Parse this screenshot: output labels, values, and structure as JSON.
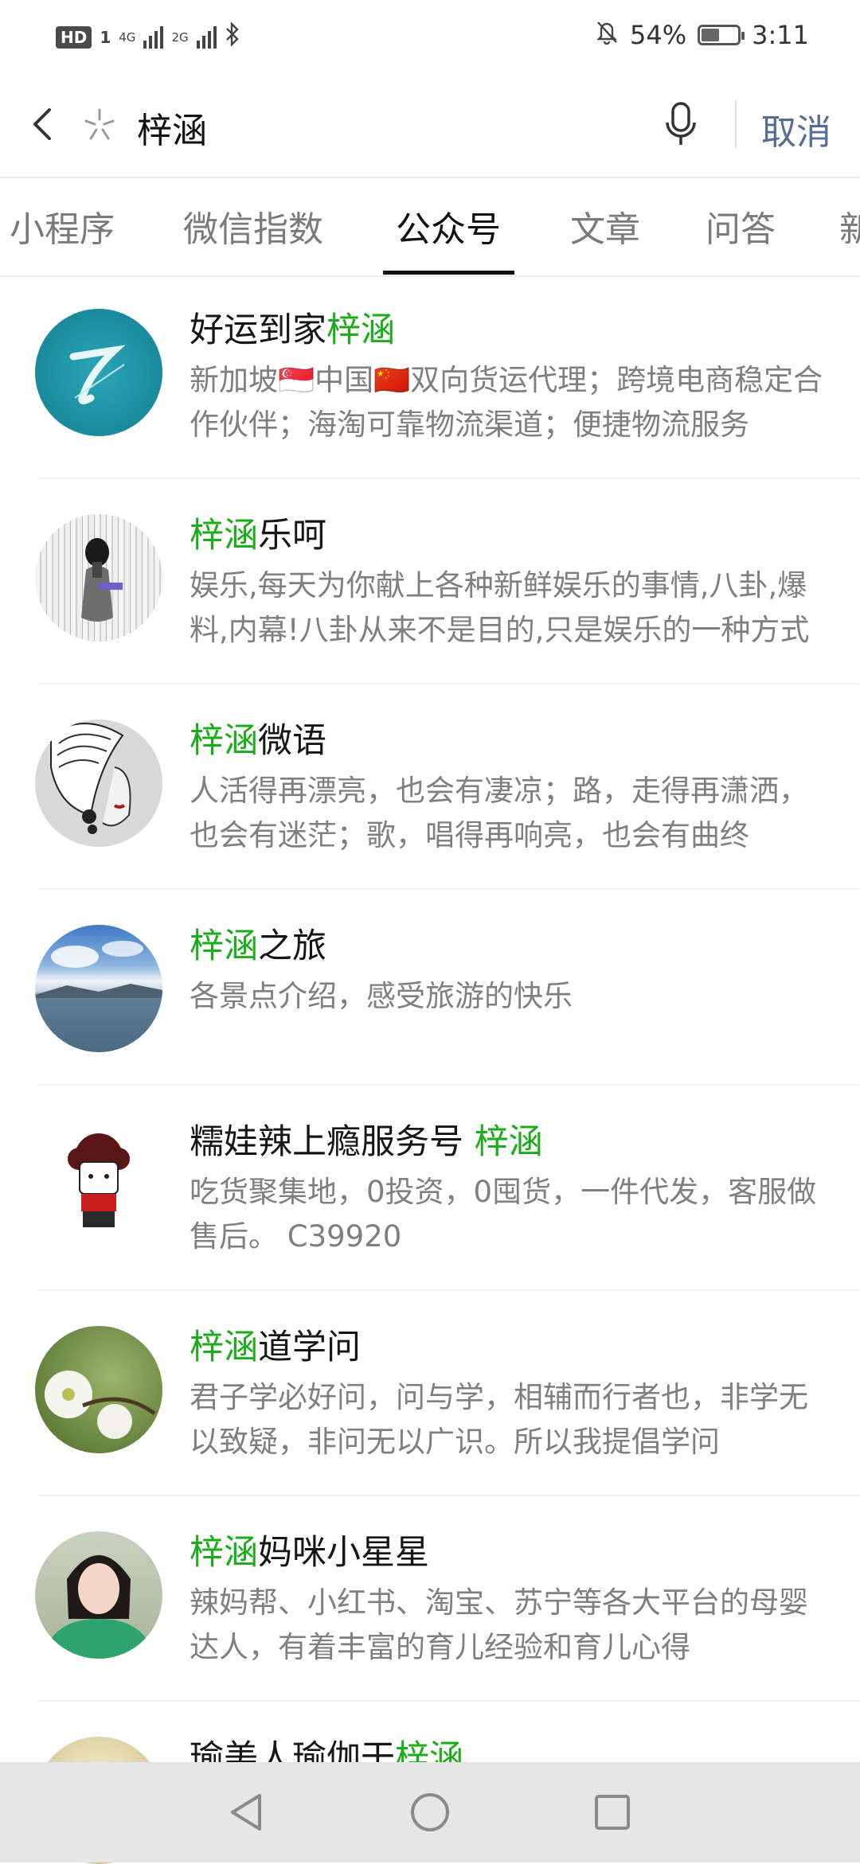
{
  "status_bar": {
    "hd": "HD",
    "sim": "1",
    "net1": "4G",
    "net2": "2G",
    "battery_percent": "54%",
    "battery_level": 0.54,
    "time": "3:11"
  },
  "search": {
    "query": "梓涵",
    "cancel_label": "取消"
  },
  "tabs": [
    {
      "label": "小程序"
    },
    {
      "label": "微信指数"
    },
    {
      "label": "公众号"
    },
    {
      "label": "文章"
    },
    {
      "label": "问答"
    },
    {
      "label": "新"
    }
  ],
  "active_tab": "公众号",
  "results": [
    {
      "pre": "好运到家",
      "hl": "梓涵",
      "post": "",
      "desc": "新加坡🇸🇬中国🇨🇳双向货运代理；跨境电商稳定合作伙伴；海淘可靠物流渠道；便捷物流服务"
    },
    {
      "pre": "",
      "hl": "梓涵",
      "post": "乐呵",
      "desc": "娱乐,每天为你献上各种新鲜娱乐的事情,八卦,爆料,内幕!八卦从来不是目的,只是娱乐的一种方式"
    },
    {
      "pre": "",
      "hl": "梓涵",
      "post": "微语",
      "desc": "人活得再漂亮，也会有凄凉；路，走得再潇洒，也会有迷茫；歌，唱得再响亮，也会有曲终"
    },
    {
      "pre": "",
      "hl": "梓涵",
      "post": "之旅",
      "desc": "各景点介绍，感受旅游的快乐"
    },
    {
      "pre": "糯娃辣上瘾服务号 ",
      "hl": "梓涵",
      "post": "",
      "desc": "吃货聚集地，0投资，0囤货，一件代发，客服做售后。 C39920"
    },
    {
      "pre": "",
      "hl": "梓涵",
      "post": "道学问",
      "desc": "君子学必好问，问与学，相辅而行者也，非学无以致疑，非问无以广识。所以我提倡学问"
    },
    {
      "pre": "",
      "hl": "梓涵",
      "post": "妈咪小星星",
      "desc": "辣妈帮、小红书、淘宝、苏宁等各大平台的母婴达人，有着丰富的育儿经验和育儿心得"
    },
    {
      "pre": "瑜美人瑜伽干",
      "hl": "梓涵",
      "post": "",
      "desc": ""
    }
  ],
  "colors": {
    "highlight": "#1aad19",
    "link": "#576b95",
    "nav_bg": "#e6e6e6"
  }
}
